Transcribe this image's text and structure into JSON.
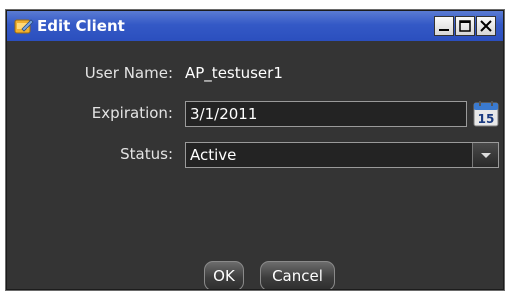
{
  "window": {
    "title": "Edit Client",
    "controls": {
      "minimize_icon": "minimize-icon",
      "maximize_icon": "maximize-icon",
      "close_icon": "close-icon"
    }
  },
  "form": {
    "user_name_label": "User Name:",
    "user_name_value": "AP_testuser1",
    "expiration_label": "Expiration:",
    "expiration_value": "3/1/2011",
    "calendar_day": "15",
    "status_label": "Status:",
    "status_value": "Active"
  },
  "buttons": {
    "ok_label": "OK",
    "cancel_label": "Cancel"
  },
  "colors": {
    "titlebar": "#2b4fbe",
    "dialog_background": "#343434",
    "field_background": "#232323"
  }
}
